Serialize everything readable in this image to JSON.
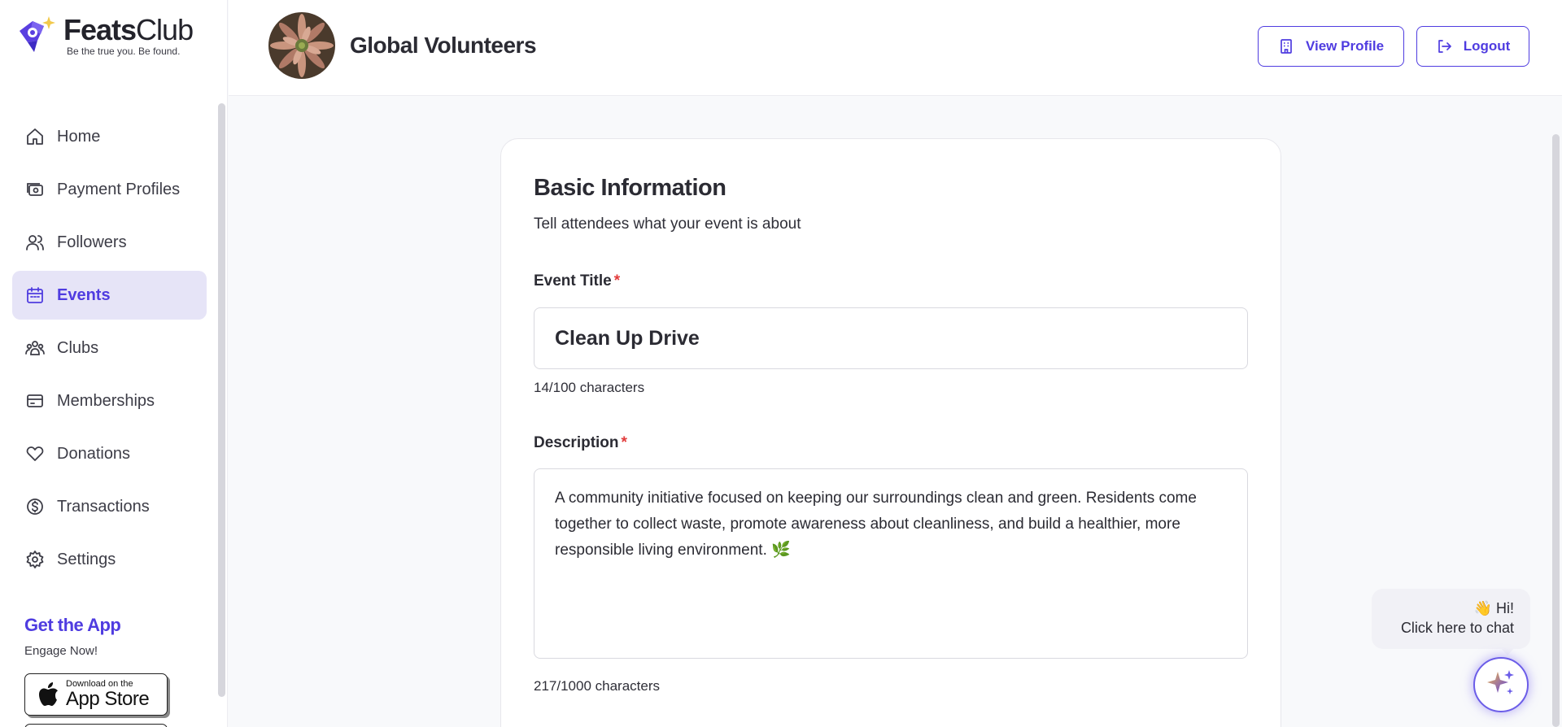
{
  "brand": {
    "name_bold": "Feats",
    "name_light": "Club",
    "tagline": "Be the true you. Be found.",
    "accent": "#4f3ce0"
  },
  "sidebar": {
    "items": [
      {
        "label": "Home",
        "icon": "home-icon",
        "active": false
      },
      {
        "label": "Payment Profiles",
        "icon": "payment-profile-icon",
        "active": false
      },
      {
        "label": "Followers",
        "icon": "users-icon",
        "active": false
      },
      {
        "label": "Events",
        "icon": "calendar-icon",
        "active": true
      },
      {
        "label": "Clubs",
        "icon": "group-icon",
        "active": false
      },
      {
        "label": "Memberships",
        "icon": "card-icon",
        "active": false
      },
      {
        "label": "Donations",
        "icon": "heart-icon",
        "active": false
      },
      {
        "label": "Transactions",
        "icon": "dollar-circle-icon",
        "active": false
      },
      {
        "label": "Settings",
        "icon": "gear-icon",
        "active": false
      }
    ],
    "get_app": {
      "title": "Get the App",
      "subtitle": "Engage Now!",
      "appstore_small": "Download on the",
      "appstore_big": "App Store"
    }
  },
  "header": {
    "org_name": "Global Volunteers",
    "view_profile": "View Profile",
    "logout": "Logout"
  },
  "form": {
    "section_title": "Basic Information",
    "section_subtitle": "Tell attendees what your event is about",
    "title_label": "Event Title",
    "title_value": "Clean Up Drive",
    "title_counter": "14/100 characters",
    "desc_label": "Description",
    "desc_value": "A community initiative focused on keeping our surroundings clean and green. Residents come together to collect waste, promote awareness about cleanliness, and build a healthier, more responsible living environment. 🌿",
    "desc_counter": "217/1000 characters",
    "required_mark": "*"
  },
  "chat": {
    "greeting": "👋 Hi!",
    "prompt": "Click here to chat"
  }
}
